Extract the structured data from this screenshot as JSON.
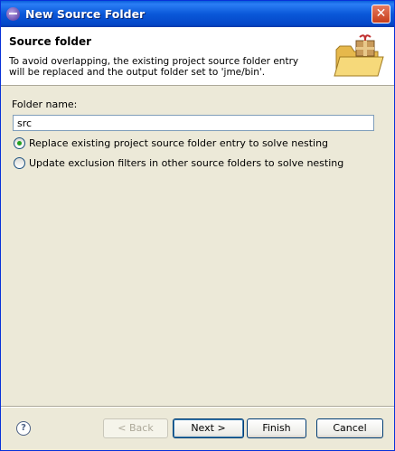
{
  "window": {
    "title": "New Source Folder",
    "close_glyph": "✕"
  },
  "header": {
    "title": "Source folder",
    "message": "To avoid overlapping, the existing project source folder entry will be replaced and the output folder set to 'jme/bin'.",
    "icon": "folder-with-package-icon"
  },
  "form": {
    "folder_name_label": "Folder name:",
    "folder_name_value": "src",
    "options": [
      {
        "label": "Replace existing project source folder entry to solve nesting",
        "checked": true
      },
      {
        "label": "Update exclusion filters in other source folders to solve nesting",
        "checked": false
      }
    ]
  },
  "footer": {
    "help_glyph": "?",
    "back_label": "< Back",
    "next_label": "Next >",
    "finish_label": "Finish",
    "cancel_label": "Cancel"
  }
}
